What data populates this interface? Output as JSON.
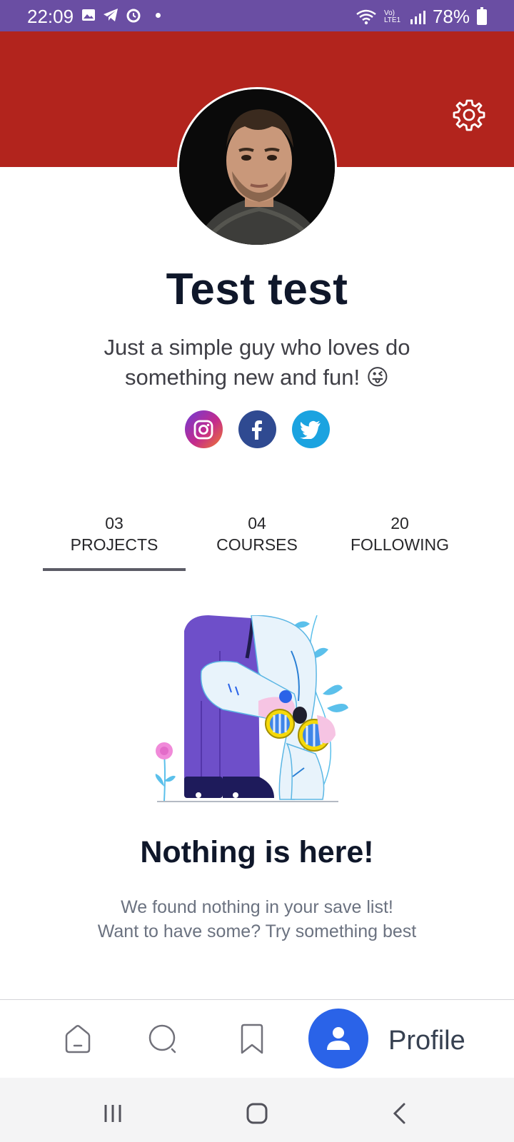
{
  "status_bar": {
    "time": "22:09",
    "battery": "78%",
    "signal_label": "Vo) LTE1"
  },
  "profile": {
    "name": "Test test",
    "bio": "Just a simple guy who loves do something new and fun! 😜"
  },
  "social": [
    {
      "icon": "instagram-icon",
      "color": "#c42b8c"
    },
    {
      "icon": "facebook-icon",
      "color": "#2f4a91"
    },
    {
      "icon": "twitter-icon",
      "color": "#1ba3e0"
    }
  ],
  "tabs": [
    {
      "count": "03",
      "label": "PROJECTS",
      "active": true
    },
    {
      "count": "04",
      "label": "COURSES",
      "active": false
    },
    {
      "count": "20",
      "label": "FOLLOWING",
      "active": false
    }
  ],
  "empty_state": {
    "title": "Nothing is here!",
    "line1": "We found nothing in your save list!",
    "line2": "Want to have some? Try something best"
  },
  "bottom_nav": {
    "items": [
      "home-icon",
      "search-icon",
      "bookmark-icon",
      "profile-icon"
    ],
    "active_label": "Profile"
  },
  "colors": {
    "status_bar": "#6a4ea3",
    "header": "#b2241d",
    "accent": "#2a63e8"
  }
}
